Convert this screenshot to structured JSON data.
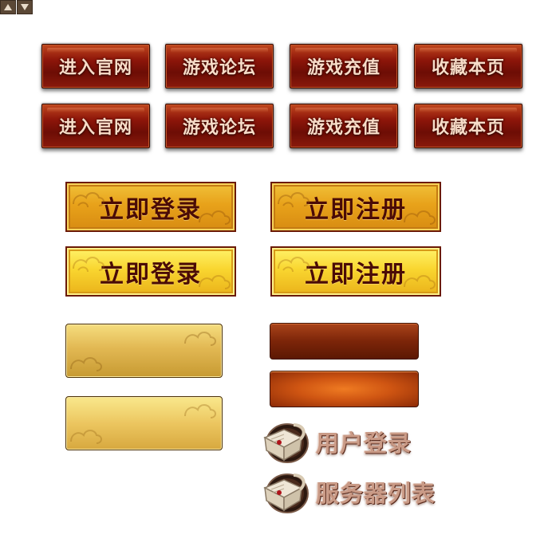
{
  "controls": {
    "scroll_up_icon": "triangle-up-icon",
    "scroll_down_icon": "triangle-down-icon"
  },
  "nav_row_1": [
    {
      "label": "进入官网"
    },
    {
      "label": "游戏论坛"
    },
    {
      "label": "游戏充值"
    },
    {
      "label": "收藏本页"
    }
  ],
  "nav_row_2": [
    {
      "label": "进入官网"
    },
    {
      "label": "游戏论坛"
    },
    {
      "label": "游戏充值"
    },
    {
      "label": "收藏本页"
    }
  ],
  "auth": {
    "login_label": "立即登录",
    "register_label": "立即注册"
  },
  "links": {
    "user_login": "用户登录",
    "server_list": "服务器列表",
    "icon": "book-icon"
  },
  "colors": {
    "nav_red": "#8e160a",
    "gold": "#e8a21a",
    "gold_text": "#4a0b06",
    "orange": "#cf5512"
  }
}
